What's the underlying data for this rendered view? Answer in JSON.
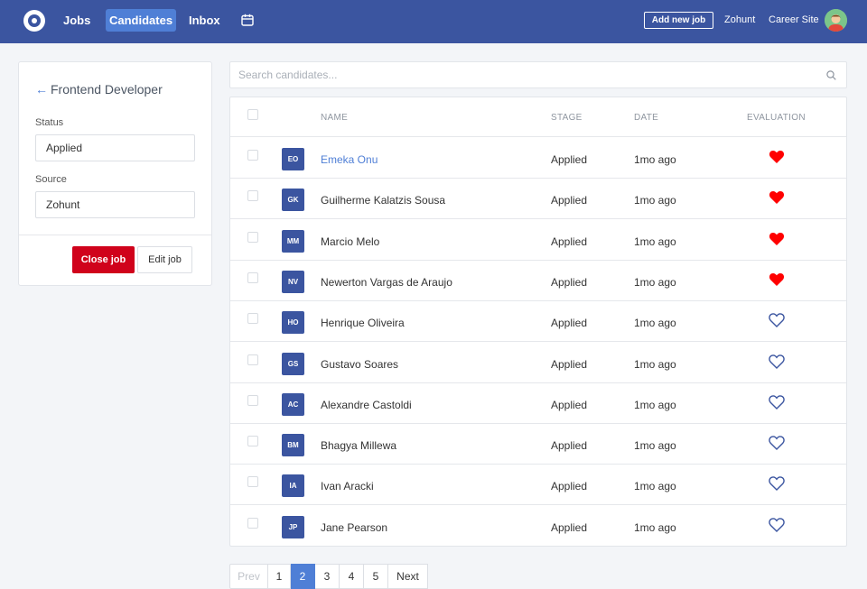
{
  "nav": {
    "links": [
      {
        "label": "Jobs"
      },
      {
        "label": "Candidates",
        "active": true
      },
      {
        "label": "Inbox"
      }
    ],
    "add_job_label": "Add new job",
    "company": "Zohunt",
    "career_site": "Career Site",
    "brand_color": "#3b55a0",
    "accent_color": "#4f7fd6"
  },
  "job": {
    "title": "Frontend Developer",
    "status_label": "Status",
    "status_value": "Applied",
    "source_label": "Source",
    "source_value": "Zohunt",
    "close_label": "Close job",
    "edit_label": "Edit job",
    "close_color": "#d0021b"
  },
  "search": {
    "placeholder": "Search candidates..."
  },
  "table": {
    "headers": {
      "name": "NAME",
      "stage": "STAGE",
      "date": "DATE",
      "evaluation": "EVALUATION"
    },
    "rows": [
      {
        "initials": "EO",
        "name": "Emeka Onu",
        "stage": "Applied",
        "date": "1mo ago",
        "liked": true,
        "highlight": true
      },
      {
        "initials": "GK",
        "name": "Guilherme Kalatzis Sousa",
        "stage": "Applied",
        "date": "1mo ago",
        "liked": true
      },
      {
        "initials": "MM",
        "name": "Marcio Melo",
        "stage": "Applied",
        "date": "1mo ago",
        "liked": true
      },
      {
        "initials": "NV",
        "name": "Newerton Vargas de Araujo",
        "stage": "Applied",
        "date": "1mo ago",
        "liked": true
      },
      {
        "initials": "HO",
        "name": "Henrique Oliveira",
        "stage": "Applied",
        "date": "1mo ago",
        "liked": false
      },
      {
        "initials": "GS",
        "name": "Gustavo Soares",
        "stage": "Applied",
        "date": "1mo ago",
        "liked": false
      },
      {
        "initials": "AC",
        "name": "Alexandre Castoldi",
        "stage": "Applied",
        "date": "1mo ago",
        "liked": false
      },
      {
        "initials": "BM",
        "name": "Bhagya Millewa",
        "stage": "Applied",
        "date": "1mo ago",
        "liked": false
      },
      {
        "initials": "IA",
        "name": "Ivan Aracki",
        "stage": "Applied",
        "date": "1mo ago",
        "liked": false
      },
      {
        "initials": "JP",
        "name": "Jane Pearson",
        "stage": "Applied",
        "date": "1mo ago",
        "liked": false
      }
    ]
  },
  "pagination": {
    "prev_label": "Prev",
    "pages": [
      "1",
      "2",
      "3",
      "4",
      "5"
    ],
    "current": "2",
    "next_label": "Next"
  }
}
